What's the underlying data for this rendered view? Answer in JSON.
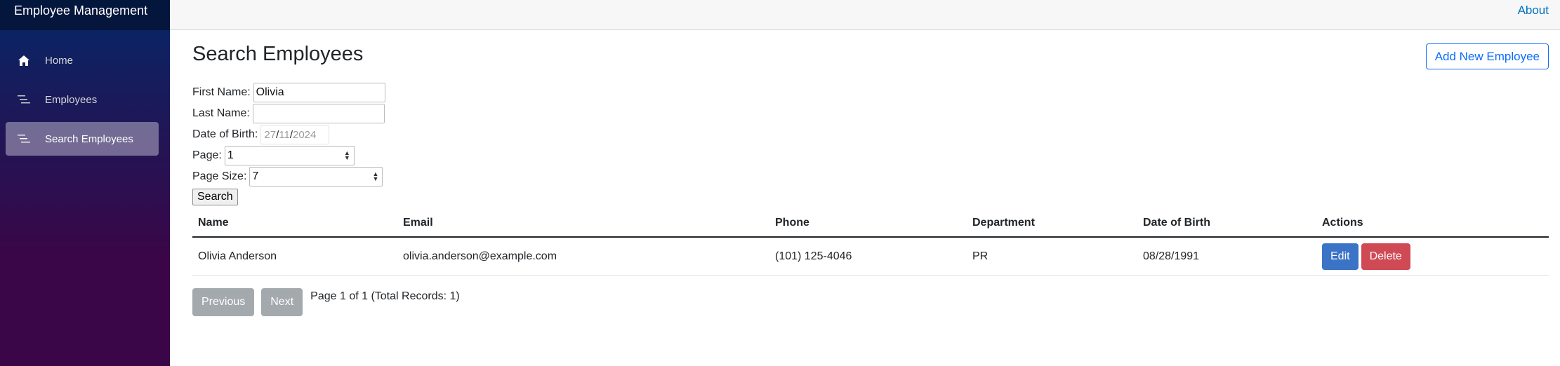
{
  "app": {
    "title": "Employee Management"
  },
  "topbar": {
    "about_label": "About"
  },
  "sidebar": {
    "items": [
      {
        "label": "Home",
        "icon": "home-icon"
      },
      {
        "label": "Employees",
        "icon": "list-icon"
      },
      {
        "label": "Search Employees",
        "icon": "list-icon",
        "active": true
      }
    ]
  },
  "page": {
    "title": "Search Employees",
    "add_button_label": "Add New Employee"
  },
  "form": {
    "first_name_label": "First Name:",
    "first_name_value": "Olivia",
    "last_name_label": "Last Name:",
    "last_name_value": "",
    "dob_label": "Date of Birth:",
    "dob_day": "27",
    "dob_month": "11",
    "dob_year": "2024",
    "dob_sep": "/",
    "page_label": "Page:",
    "page_value": "1",
    "page_size_label": "Page Size:",
    "page_size_value": "7",
    "search_button_label": "Search"
  },
  "table": {
    "headers": [
      "Name",
      "Email",
      "Phone",
      "Department",
      "Date of Birth",
      "Actions"
    ],
    "rows": [
      {
        "name": "Olivia Anderson",
        "email": "olivia.anderson@example.com",
        "phone": "(101) 125-4046",
        "department": "PR",
        "dob": "08/28/1991",
        "edit_label": "Edit",
        "delete_label": "Delete"
      }
    ]
  },
  "pager": {
    "previous_label": "Previous",
    "next_label": "Next",
    "info": "Page 1 of 1 (Total Records: 1)"
  },
  "colors": {
    "accent": "#0d6efd",
    "edit": "#3b73c6",
    "delete": "#cf4a55",
    "disabled": "#a4a9ae"
  }
}
